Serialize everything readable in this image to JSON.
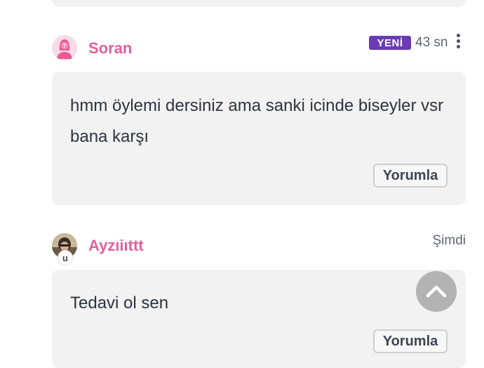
{
  "posts": [
    {
      "author": "Soran",
      "badge": "YENİ",
      "time": "43 sn",
      "message": "hmm öylemi dersiniz ama sanki icinde biseyler vsr bana karşı",
      "comment_label": "Yorumla",
      "avatar_icon": "anonymous-female-icon"
    },
    {
      "author": "Ayzıiıttt",
      "time": "Şimdi",
      "avatar_badge": "u",
      "message": "Tedavi ol sen",
      "comment_label": "Yorumla",
      "avatar_icon": "user-photo"
    }
  ],
  "icons": {
    "more": "more-vertical-icon",
    "scroll_top": "chevron-up-icon"
  },
  "colors": {
    "username": "#e0609b",
    "badge_new": "#6a3bb5",
    "card_bg": "#f2f2f2"
  }
}
